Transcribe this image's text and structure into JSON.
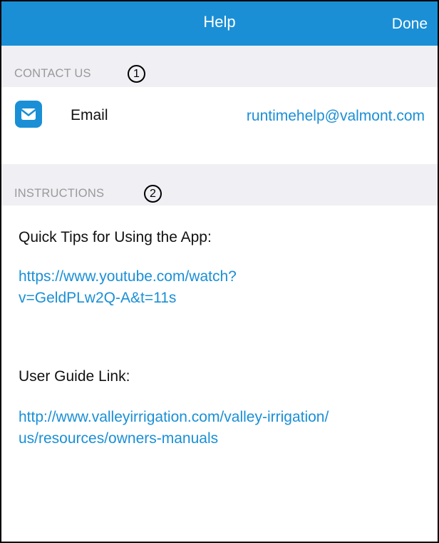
{
  "header": {
    "title": "Help",
    "done_label": "Done"
  },
  "contact_section": {
    "header": "CONTACT US",
    "badge": "1",
    "email_label": "Email",
    "email_value": "runtimehelp@valmont.com",
    "icon": "mail-icon"
  },
  "instructions_section": {
    "header": "INSTRUCTIONS",
    "badge": "2",
    "quick_tips_label": "Quick Tips for Using the App:",
    "quick_tips_link_line1": "https://www.youtube.com/watch?",
    "quick_tips_link_line2": "v=GeldPLw2Q-A&t=11s",
    "user_guide_label": "User Guide Link:",
    "user_guide_link_line1": "http://www.valleyirrigation.com/valley-irrigation/",
    "user_guide_link_line2": "us/resources/owners-manuals"
  },
  "colors": {
    "accent": "#1a8fd6",
    "section_bg": "#efeff4",
    "section_text": "#9a9a9a"
  }
}
